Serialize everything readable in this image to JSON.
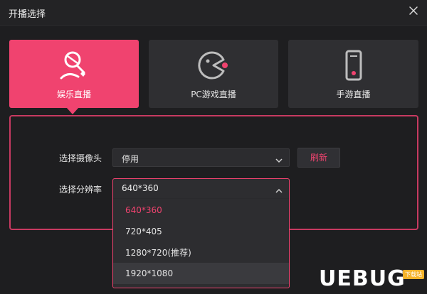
{
  "window": {
    "title": "开播选择"
  },
  "cards": [
    {
      "label": "娱乐直播",
      "icon": "live-mic-icon",
      "active": true
    },
    {
      "label": "PC游戏直播",
      "icon": "pacman-icon",
      "active": false
    },
    {
      "label": "手游直播",
      "icon": "phone-icon",
      "active": false
    }
  ],
  "camera": {
    "label": "选择摄像头",
    "value": "停用",
    "refresh_label": "刷新"
  },
  "resolution": {
    "label": "选择分辨率",
    "value": "640*360",
    "options": [
      "640*360",
      "720*405",
      "1280*720(推荐)",
      "1920*1080"
    ]
  },
  "watermark": {
    "text": "UEBUG",
    "tag": "下载站"
  },
  "colors": {
    "accent": "#f0436f",
    "background": "#1e1e20",
    "card": "#2f2f32"
  }
}
